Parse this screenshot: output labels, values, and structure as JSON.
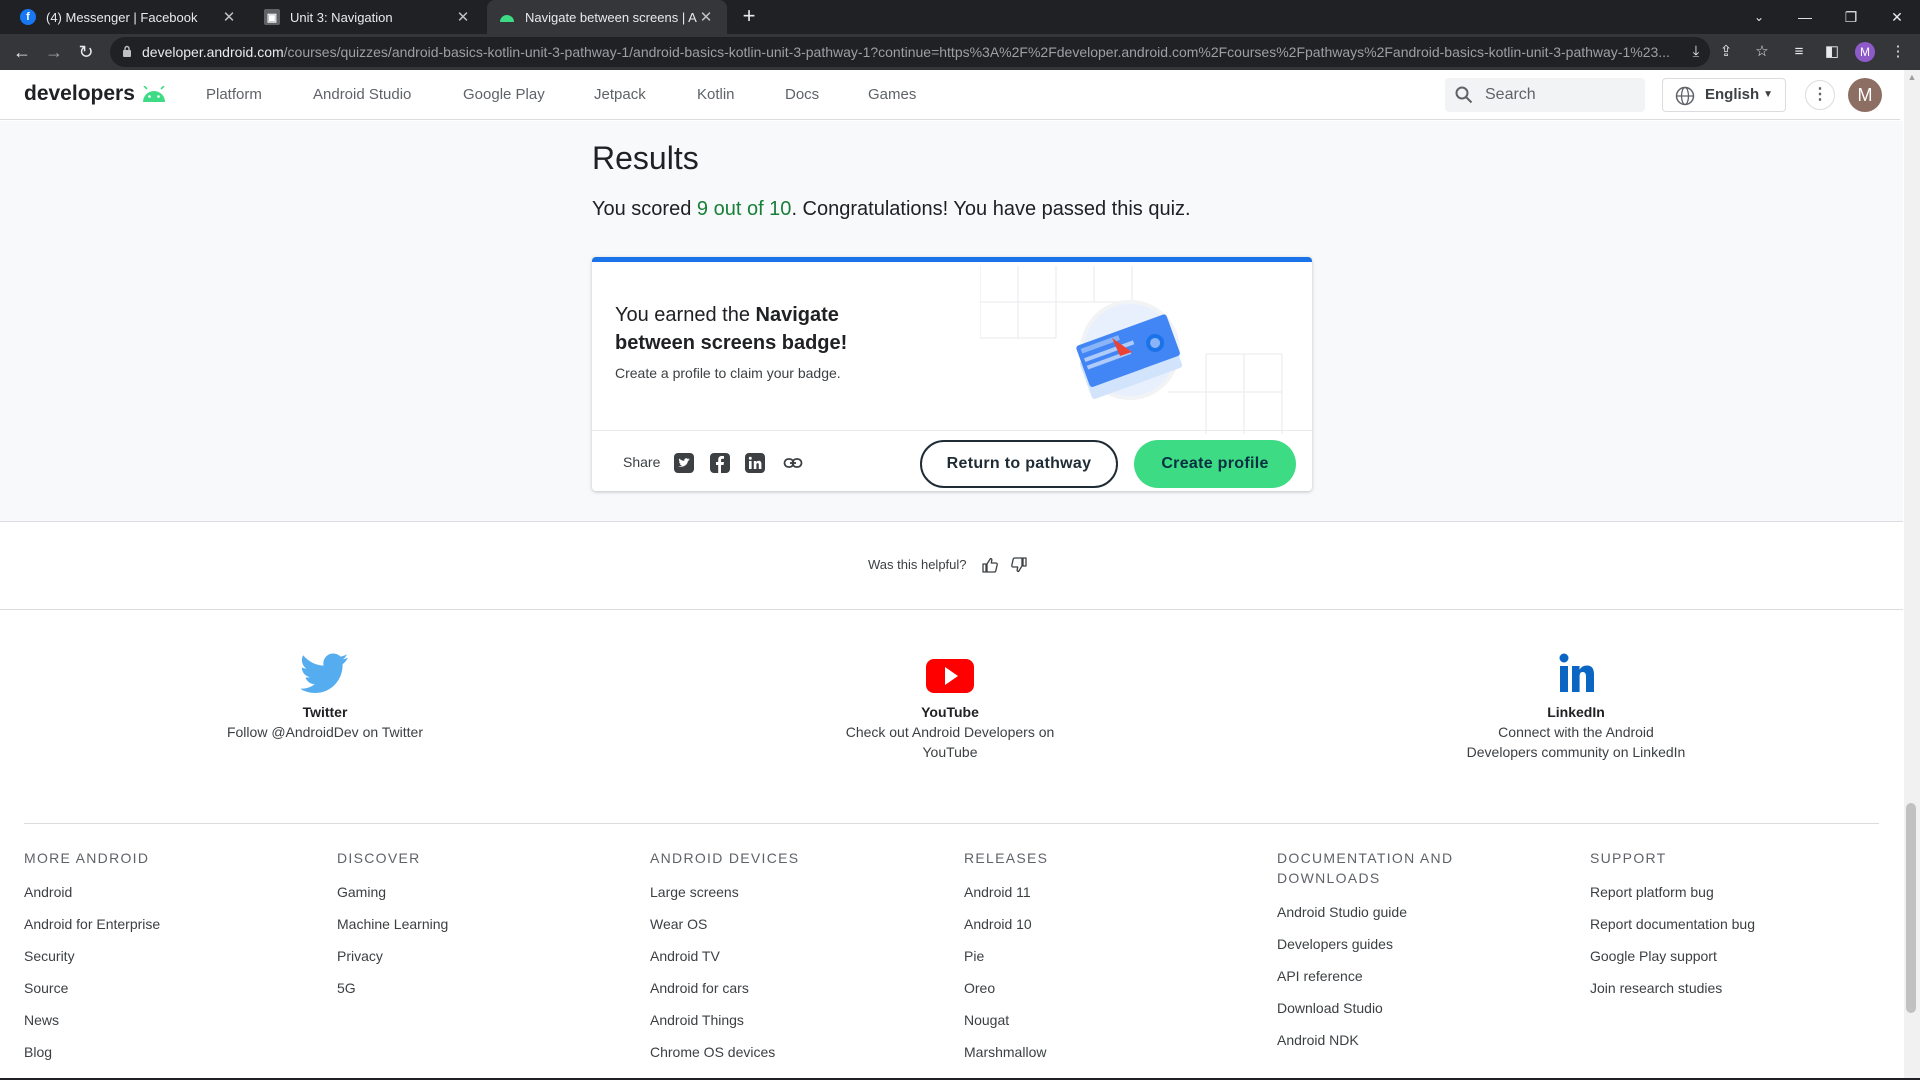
{
  "browser": {
    "tabs": [
      {
        "title": "(4) Messenger | Facebook",
        "active": false
      },
      {
        "title": "Unit 3: Navigation",
        "active": false
      },
      {
        "title": "Navigate between screens  |  Android",
        "active": true
      }
    ],
    "url_host": "developer.android.com",
    "url_path": "/courses/quizzes/android-basics-kotlin-unit-3-pathway-1/android-basics-kotlin-unit-3-pathway-1?continue=https%3A%2F%2Fdeveloper.android.com%2Fcourses%2Fpathways%2Fandroid-basics-kotlin-unit-3-pathway-1%23...",
    "profile_initial": "M"
  },
  "header": {
    "logo_text": "developers",
    "nav": [
      "Platform",
      "Android Studio",
      "Google Play",
      "Jetpack",
      "Kotlin",
      "Docs",
      "Games"
    ],
    "search_placeholder": "Search",
    "language": "English",
    "avatar_initial": "M"
  },
  "results": {
    "heading": "Results",
    "score_prefix": "You scored ",
    "score": "9 out of 10",
    "score_suffix": ". Congratulations! You have passed this quiz."
  },
  "badge_card": {
    "title_prefix": "You earned the ",
    "title_badge": "Navigate between screens badge!",
    "subtitle": "Create a profile to claim your badge.",
    "share_label": "Share",
    "return_button": "Return to pathway",
    "create_button": "Create profile"
  },
  "feedback": {
    "question": "Was this helpful?"
  },
  "social": [
    {
      "title": "Twitter",
      "desc": "Follow @AndroidDev on Twitter"
    },
    {
      "title": "YouTube",
      "desc": "Check out Android Developers on YouTube"
    },
    {
      "title": "LinkedIn",
      "desc": "Connect with the Android Developers community on LinkedIn"
    }
  ],
  "footer": [
    {
      "heading": "MORE ANDROID",
      "links": [
        "Android",
        "Android for Enterprise",
        "Security",
        "Source",
        "News",
        "Blog"
      ]
    },
    {
      "heading": "DISCOVER",
      "links": [
        "Gaming",
        "Machine Learning",
        "Privacy",
        "5G"
      ]
    },
    {
      "heading": "ANDROID DEVICES",
      "links": [
        "Large screens",
        "Wear OS",
        "Android TV",
        "Android for cars",
        "Android Things",
        "Chrome OS devices"
      ]
    },
    {
      "heading": "RELEASES",
      "links": [
        "Android 11",
        "Android 10",
        "Pie",
        "Oreo",
        "Nougat",
        "Marshmallow"
      ]
    },
    {
      "heading": "DOCUMENTATION AND DOWNLOADS",
      "links": [
        "Android Studio guide",
        "Developers guides",
        "API reference",
        "Download Studio",
        "Android NDK"
      ]
    },
    {
      "heading": "SUPPORT",
      "links": [
        "Report platform bug",
        "Report documentation bug",
        "Google Play support",
        "Join research studies"
      ]
    }
  ],
  "colors": {
    "accent_blue": "#1a73e8",
    "android_green": "#3ddc84",
    "score_green": "#188038"
  }
}
